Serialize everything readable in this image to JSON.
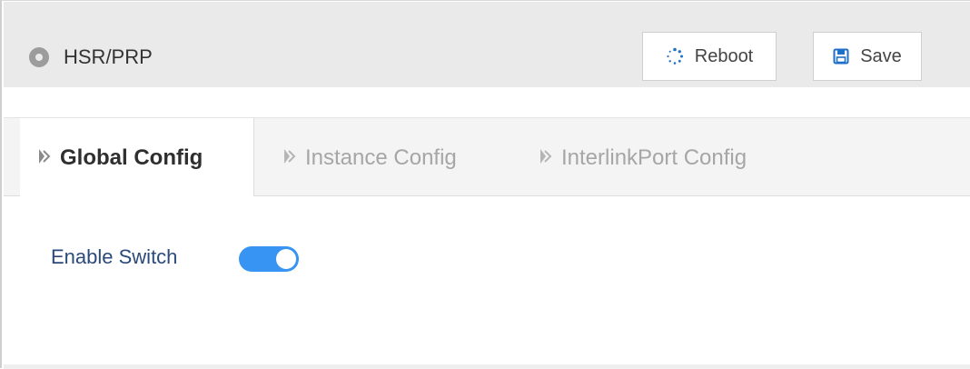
{
  "header": {
    "icon": "location-pin-icon",
    "title": "HSR/PRP"
  },
  "toolbar": {
    "reboot_label": "Reboot",
    "reboot_icon": "spinner-icon",
    "save_label": "Save",
    "save_icon": "floppy-disk-icon"
  },
  "tabs": [
    {
      "label": "Global Config",
      "active": true,
      "icon": "chevron-right-icon"
    },
    {
      "label": "Instance Config",
      "active": false,
      "icon": "chevron-right-icon"
    },
    {
      "label": "InterlinkPort Config",
      "active": false,
      "icon": "chevron-right-icon"
    }
  ],
  "settings": {
    "enable_switch_label": "Enable Switch",
    "enable_switch_on": true
  },
  "colors": {
    "header_bg": "#eaeaea",
    "toggle_on": "#3794f2",
    "label_text": "#2b4a7b",
    "icon_blue": "#1e6fc7"
  }
}
